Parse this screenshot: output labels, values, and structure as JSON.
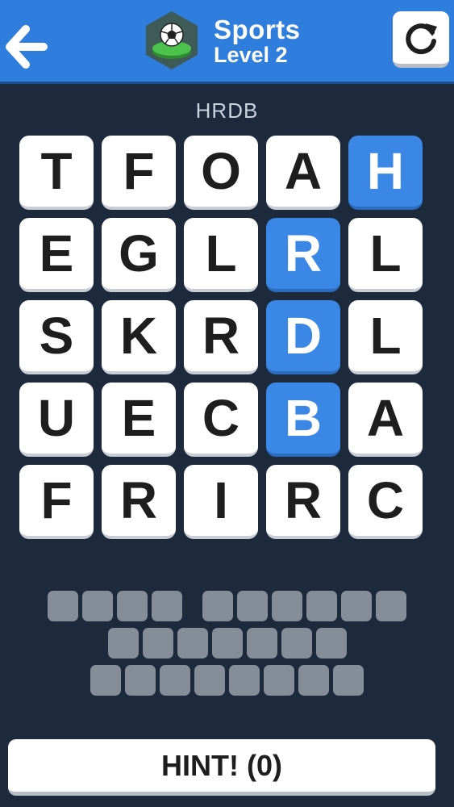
{
  "header": {
    "category": "Sports",
    "level": "Level 2",
    "badge_icon": "soccer-ball-icon",
    "back_icon": "arrow-left-icon",
    "restart_icon": "restart-icon"
  },
  "current_word": "HRDB",
  "grid": {
    "rows": [
      [
        "T",
        "F",
        "O",
        "A",
        "H"
      ],
      [
        "E",
        "G",
        "L",
        "R",
        "L"
      ],
      [
        "S",
        "K",
        "R",
        "D",
        "L"
      ],
      [
        "U",
        "E",
        "C",
        "B",
        "A"
      ],
      [
        "F",
        "R",
        "I",
        "R",
        "C"
      ]
    ],
    "selected": [
      [
        0,
        4
      ],
      [
        1,
        3
      ],
      [
        2,
        3
      ],
      [
        3,
        3
      ]
    ]
  },
  "answer_slots": {
    "rows": [
      [
        4,
        6
      ],
      [
        7
      ],
      [
        8
      ]
    ]
  },
  "hint": {
    "label": "HINT! (0)"
  },
  "colors": {
    "background": "#1c2a3c",
    "header": "#2f7ddc",
    "selected_tile": "#3a87e6",
    "slot": "#858d99"
  }
}
